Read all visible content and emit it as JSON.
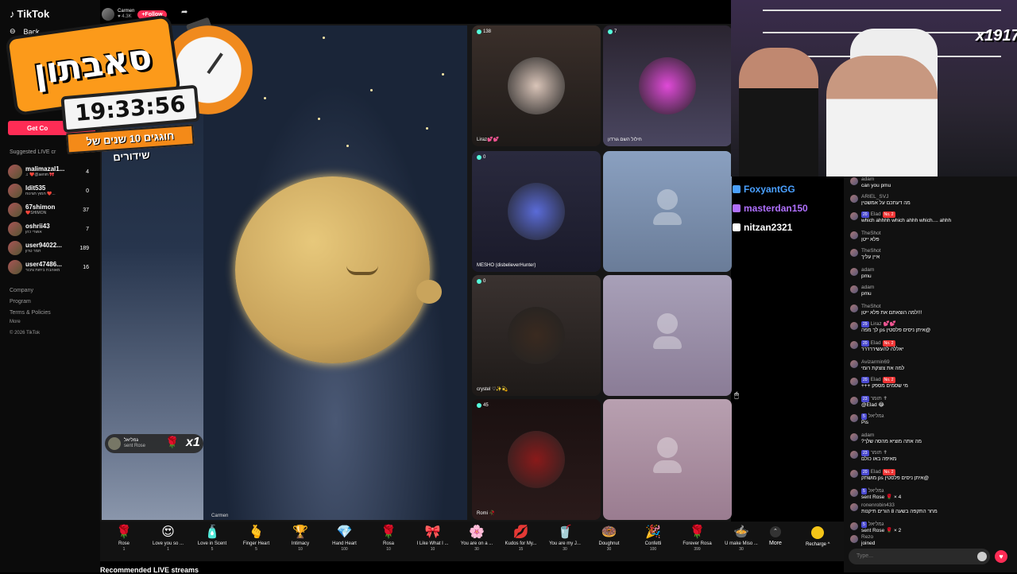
{
  "app": {
    "logo": "TikTok",
    "back": "Back",
    "get_coins": "Get Co"
  },
  "sidebar": {
    "suggested_title": "Suggested LIVE cr",
    "items": [
      {
        "name": "malimazal1...",
        "sub": "♫ ❤️@aenm 🎀",
        "count": "4"
      },
      {
        "name": "ldit535",
        "sub": "חמוץ חצינוח ❤️...",
        "count": "0"
      },
      {
        "name": "67shimon",
        "sub": "❤️SHIMON",
        "count": "37"
      },
      {
        "name": "oshrii43",
        "sub": "אושרי כהן",
        "count": "7"
      },
      {
        "name": "user94022...",
        "sub": "תמר טרון",
        "count": "189"
      },
      {
        "name": "user47486...",
        "sub": "מאוהבת ביחות ציבור",
        "count": "16"
      }
    ],
    "footer": [
      "Company",
      "Program",
      "Terms & Policies",
      "More",
      "© 2026 TikTok"
    ]
  },
  "overlay": {
    "title": "סאבתון",
    "timer": "19:33:56",
    "tagline": "חוגגים 10 שנים של שידורים"
  },
  "host": {
    "name": "Carmen",
    "likes": "♥ 4.3K",
    "follow": "+Follow"
  },
  "stream": {
    "main_label": "Carmen",
    "gift_notice": {
      "user": "גמליאל",
      "action": "sent Rose",
      "multiplier": "x1"
    },
    "tiles": [
      {
        "count": "138",
        "label": "Liraz💕💕",
        "color": "#d9c4b8"
      },
      {
        "count": "7",
        "label": "חילול השם גורדון",
        "color": "#e04ad8"
      },
      {
        "count": "0",
        "label": "MESHO (disbelieverHunter)",
        "color": "#5a6bd8"
      },
      {
        "count": "0",
        "label": "crystel ♡✨💫",
        "color": "#3a2a20"
      },
      {
        "count": "45",
        "label": "Romi 🥀",
        "color": "#8a1a1a"
      }
    ]
  },
  "gifts": [
    {
      "icon": "🌹",
      "name": "Rose",
      "price": "1"
    },
    {
      "icon": "😍",
      "name": "Love you so ...",
      "price": "1"
    },
    {
      "icon": "🧴",
      "name": "Love in Scent",
      "price": "5"
    },
    {
      "icon": "🫰",
      "name": "Finger Heart",
      "price": "5"
    },
    {
      "icon": "🏆",
      "name": "Intimacy",
      "price": "10"
    },
    {
      "icon": "💎",
      "name": "Hand Heart",
      "price": "100"
    },
    {
      "icon": "🌹",
      "name": "Rosa",
      "price": "10"
    },
    {
      "icon": "🎀",
      "name": "I Like What I ...",
      "price": "10"
    },
    {
      "icon": "🌸",
      "name": "You are on a ...",
      "price": "30"
    },
    {
      "icon": "💋",
      "name": "Kudos for My...",
      "price": "15"
    },
    {
      "icon": "🥤",
      "name": "You are my J...",
      "price": "30"
    },
    {
      "icon": "🍩",
      "name": "Doughnut",
      "price": "30"
    },
    {
      "icon": "🎉",
      "name": "Confetti",
      "price": "100"
    },
    {
      "icon": "🌹",
      "name": "Forever Rosa",
      "price": "399"
    },
    {
      "icon": "🍲",
      "name": "U make Miso ...",
      "price": "30"
    }
  ],
  "gift_bar": {
    "more": "More",
    "recharge": "Recharge ^"
  },
  "recommended": "Recommended LIVE streams",
  "cam": {
    "badge": "x1917"
  },
  "alerts": [
    {
      "name": "FoxyantGG",
      "color": "#4aa0ff"
    },
    {
      "name": "masterdan150",
      "color": "#b070ff"
    },
    {
      "name": "nitzan2321",
      "color": "#ffffff"
    }
  ],
  "chat": [
    {
      "name": "adam",
      "badge": "",
      "extra": "",
      "text": "can you pmu"
    },
    {
      "name": "ARIEL_SVJ",
      "badge": "",
      "extra": "",
      "text": "מה דעתכם על אמשטין"
    },
    {
      "name": "Elad",
      "badge": "20",
      "extra": "No. 2",
      "text": "which ahhhh which ahhh which.... ahhh"
    },
    {
      "name": "TheShot",
      "badge": "",
      "extra": "",
      "text": "פלא ייטן"
    },
    {
      "name": "TheShot",
      "badge": "",
      "extra": "",
      "text": "איין עליך"
    },
    {
      "name": "adam",
      "badge": "",
      "extra": "",
      "text": "pmu"
    },
    {
      "name": "adam",
      "badge": "",
      "extra": "",
      "text": "pmu"
    },
    {
      "name": "TheShot",
      "badge": "",
      "extra": "",
      "text": "למה הוצאתם את פלא ייטן!!!"
    },
    {
      "name": "Liraz 💕💕",
      "badge": "29",
      "extra": "",
      "text": "לך מפה ps איתן ניסים פלסטין@"
    },
    {
      "name": "Elad",
      "badge": "20",
      "extra": "No. 2",
      "text": "יאללה להעשיררררר"
    },
    {
      "name": "Avizarmin69",
      "badge": "",
      "extra": "",
      "text": "למה את צוצקת רומי"
    },
    {
      "name": "Elad",
      "badge": "20",
      "extra": "No. 2",
      "text": "+++ מי שסמים מספק"
    },
    {
      "name": "תומר ✝",
      "badge": "23",
      "extra": "",
      "text": "@Elad 😂"
    },
    {
      "name": "גמליאל",
      "badge": "5",
      "extra": "",
      "text": "Pis"
    },
    {
      "name": "adam",
      "badge": "",
      "extra": "",
      "text": "?מה אתה מוציא מהסה שלך"
    },
    {
      "name": "תומר ✝",
      "badge": "23",
      "extra": "",
      "text": "מאיפה באו כולם"
    },
    {
      "name": "Elad",
      "badge": "20",
      "extra": "No. 2",
      "text": "מושתק ps איתן ניסים פלסטין@"
    },
    {
      "name": "גמליאל",
      "badge": "5",
      "extra": "",
      "text": "sent Rose 🌹 × 4"
    },
    {
      "name": "ronenrobin433",
      "badge": "",
      "extra": "",
      "text": "מחר התקפה בשעה 8 הורים תיקנות"
    },
    {
      "name": "גמליאל",
      "badge": "5",
      "extra": "",
      "text": "sent Rose 🌹 × 2"
    },
    {
      "name": "Rezo",
      "badge": "",
      "extra": "",
      "text": "joined"
    }
  ],
  "chat_input": {
    "placeholder": "Type..."
  }
}
